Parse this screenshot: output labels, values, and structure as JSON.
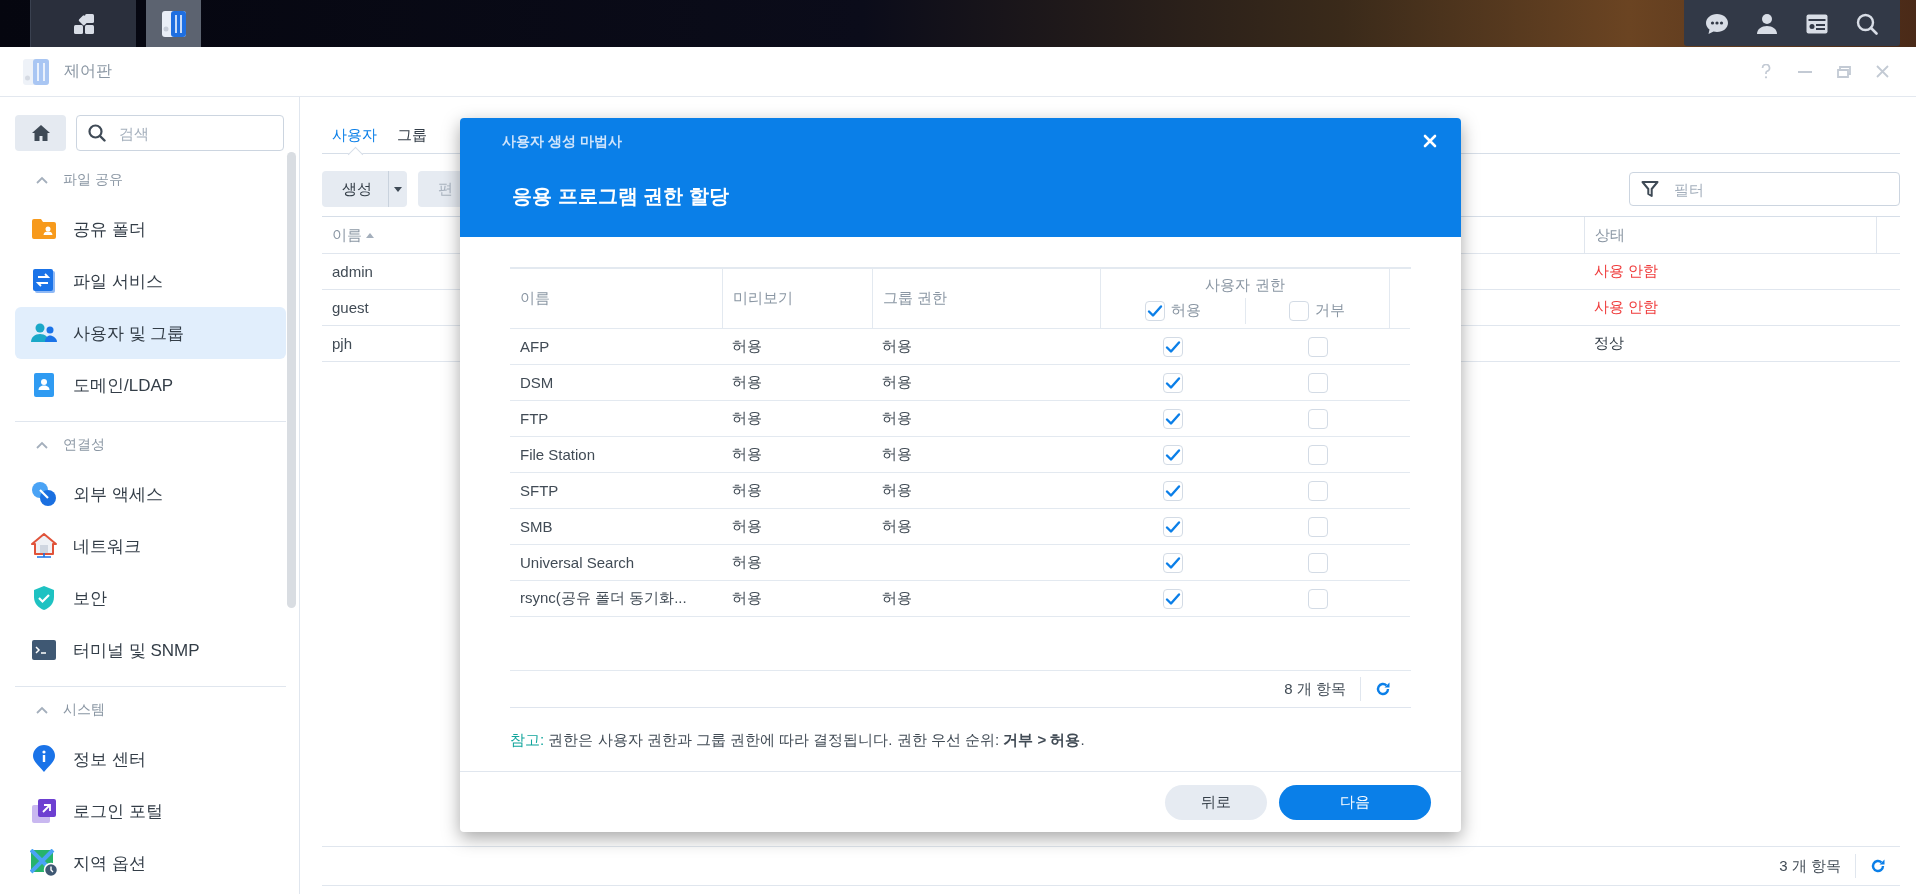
{
  "window": {
    "title": "제어판"
  },
  "sidebar": {
    "search": {
      "placeholder": "검색"
    },
    "sections": [
      {
        "title": "파일 공유",
        "expanded": true,
        "items": [
          {
            "label": "공유 폴더",
            "selected": false
          },
          {
            "label": "파일 서비스",
            "selected": false
          },
          {
            "label": "사용자 및 그룹",
            "selected": true
          },
          {
            "label": "도메인/LDAP",
            "selected": false
          }
        ]
      },
      {
        "title": "연결성",
        "expanded": true,
        "items": [
          {
            "label": "외부 액세스",
            "selected": false
          },
          {
            "label": "네트워크",
            "selected": false
          },
          {
            "label": "보안",
            "selected": false
          },
          {
            "label": "터미널 및 SNMP",
            "selected": false
          }
        ]
      },
      {
        "title": "시스템",
        "expanded": true,
        "items": [
          {
            "label": "정보 센터",
            "selected": false
          },
          {
            "label": "로그인 포털",
            "selected": false
          },
          {
            "label": "지역 옵션",
            "selected": false
          }
        ]
      }
    ]
  },
  "tabs": [
    {
      "label": "사용자",
      "selected": true
    },
    {
      "label": "그룹",
      "selected": false
    }
  ],
  "toolbar": {
    "buttons": [
      {
        "label": "생성",
        "disabled": false,
        "has_menu": true
      },
      {
        "label": "편",
        "disabled": true,
        "has_menu": false
      }
    ],
    "filter": {
      "placeholder": "필터"
    }
  },
  "users_table": {
    "columns": [
      {
        "label": "이름",
        "sort_ascending": true
      },
      {
        "label": "상태"
      }
    ],
    "rows": [
      {
        "name": "admin",
        "status": "사용 안함",
        "kind": "inactive"
      },
      {
        "name": "guest",
        "status": "사용 안함",
        "kind": "inactive"
      },
      {
        "name": "pjh",
        "status": "정상",
        "kind": "normal"
      }
    ],
    "count": "3 개 항목"
  },
  "dialog": {
    "title": "사용자 생성 마법사",
    "heading": "응용 프로그램 권한 할당",
    "columns": {
      "name": "이름",
      "preview": "미리보기",
      "group": "그룹 권한",
      "user": "사용자 권한",
      "allow": "허용",
      "deny": "거부"
    },
    "allow_all": true,
    "deny_all": false,
    "rows": [
      {
        "name": "AFP",
        "preview": "허용",
        "group": "허용",
        "allow": true,
        "deny": false
      },
      {
        "name": "DSM",
        "preview": "허용",
        "group": "허용",
        "allow": true,
        "deny": false
      },
      {
        "name": "FTP",
        "preview": "허용",
        "group": "허용",
        "allow": true,
        "deny": false
      },
      {
        "name": "File Station",
        "preview": "허용",
        "group": "허용",
        "allow": true,
        "deny": false
      },
      {
        "name": "SFTP",
        "preview": "허용",
        "group": "허용",
        "allow": true,
        "deny": false
      },
      {
        "name": "SMB",
        "preview": "허용",
        "group": "허용",
        "allow": true,
        "deny": false
      },
      {
        "name": "Universal Search",
        "preview": "허용",
        "allow": true,
        "deny": false
      },
      {
        "name": "rsync(공유 폴더 동기화...",
        "preview": "허용",
        "group": "허용",
        "allow": true,
        "deny": false
      }
    ],
    "count": "8 개 항목",
    "note_label": "참고:",
    "note": "권한은 사용자 권한과 그룹 권한에 따라 결정됩니다. 권한 우선 순위: **거부 > 허용**.",
    "buttons": {
      "back": "뒤로",
      "next": "다음"
    }
  }
}
